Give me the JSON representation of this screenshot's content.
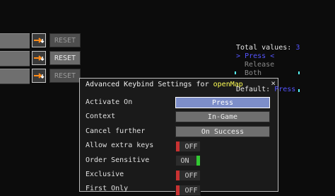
{
  "rows": [
    {
      "reset_label": "RESET",
      "enabled": false
    },
    {
      "reset_label": "RESET",
      "enabled": true
    },
    {
      "reset_label": "RESET",
      "enabled": false
    }
  ],
  "info": {
    "total_label": "Total values:",
    "total_value": "3",
    "selected_marker": ">",
    "selected": "Press",
    "selected_end": "<",
    "opt_release": "Release",
    "opt_both": "Both",
    "default_label": "Default:",
    "default_value": "Press"
  },
  "panel": {
    "title_prefix": "Advanced Keybind Settings for",
    "title_key": "openMap",
    "close": "×",
    "settings": [
      {
        "label": "Activate On",
        "value": "Press",
        "kind": "button",
        "active": true
      },
      {
        "label": "Context",
        "value": "In-Game",
        "kind": "button"
      },
      {
        "label": "Cancel further",
        "value": "On Success",
        "kind": "button"
      },
      {
        "label": "Allow extra keys",
        "value": "OFF",
        "kind": "toggle",
        "on": false
      },
      {
        "label": "Order Sensitive",
        "value": "ON",
        "kind": "toggle",
        "on": true
      },
      {
        "label": "Exclusive",
        "value": "OFF",
        "kind": "toggle",
        "on": false
      },
      {
        "label": "First Only",
        "value": "OFF",
        "kind": "toggle",
        "on": false
      }
    ]
  },
  "colors": {
    "accent_blue": "#5555ff",
    "highlight_yellow": "#ffff55",
    "toggle_off": "#c83232",
    "toggle_on": "#32c832"
  },
  "icons": {
    "advanced": "arrow-settings-icon"
  }
}
